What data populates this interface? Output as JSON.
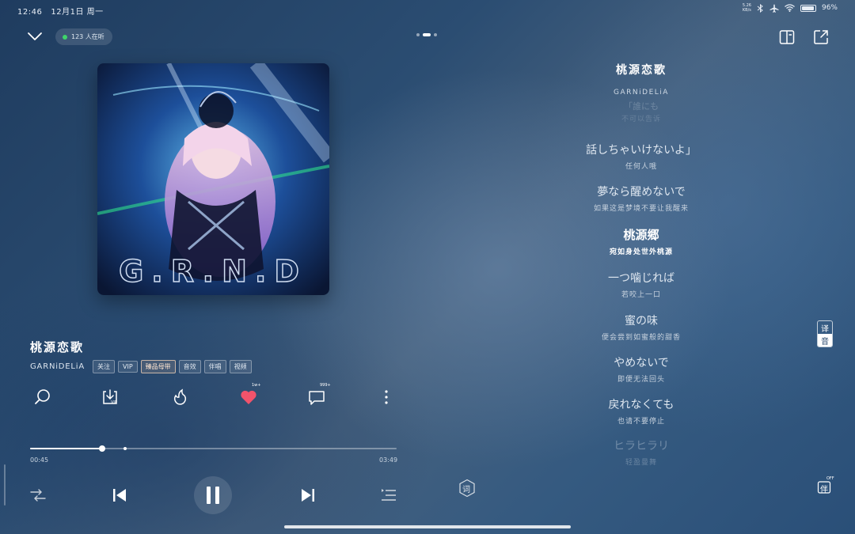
{
  "status_bar": {
    "time": "12:46",
    "date": "12月1日 周一",
    "net_speed_value": "5.26",
    "net_speed_unit": "KB/s",
    "battery": "96%",
    "battery_level": 0.96
  },
  "top_bar": {
    "listeners": "123 人在听",
    "page_count": 3,
    "active_page": 2
  },
  "song": {
    "title": "桃源恋歌",
    "artist": "GARNiDELiA",
    "tags": [
      "关注",
      "VIP",
      "臻品母带",
      "音效",
      "伴唱",
      "视频"
    ],
    "highlighted_tag": "臻品母带",
    "cover_text": "G.R.N.D"
  },
  "actions": {
    "download_badge": "VIP",
    "like_count": "1w+",
    "comment_count": "999+"
  },
  "progress": {
    "current": "00:45",
    "total": "03:49",
    "fraction": 0.196,
    "marker_fraction": 0.26
  },
  "controls": {
    "lyric_btn_label": "词"
  },
  "lyrics": {
    "title": "桃源恋歌",
    "artist": "GARNiDELiA",
    "lines": [
      {
        "jp": "「誰にも",
        "cn": "不可以告诉"
      },
      {
        "jp": "話しちゃいけないよ」",
        "cn": "任何人哦"
      },
      {
        "jp": "夢なら醒めないで",
        "cn": "如果这是梦境不要让我醒来"
      },
      {
        "jp": "桃源郷",
        "cn": "宛如身处世外桃源"
      },
      {
        "jp": "一つ噛じれば",
        "cn": "若咬上一口"
      },
      {
        "jp": "蜜の味",
        "cn": "便会尝到如蜜般的甜香"
      },
      {
        "jp": "やめないで",
        "cn": "即便无法回头"
      },
      {
        "jp": "戻れなくても",
        "cn": "也请不要停止"
      },
      {
        "jp": "ヒラヒラリ",
        "cn": "轻盈曼舞"
      }
    ],
    "current_index": 3
  },
  "side": {
    "translate_label": "译",
    "phonetic_label": "音",
    "accompany_label": "伴",
    "accompany_state": "OFF"
  }
}
